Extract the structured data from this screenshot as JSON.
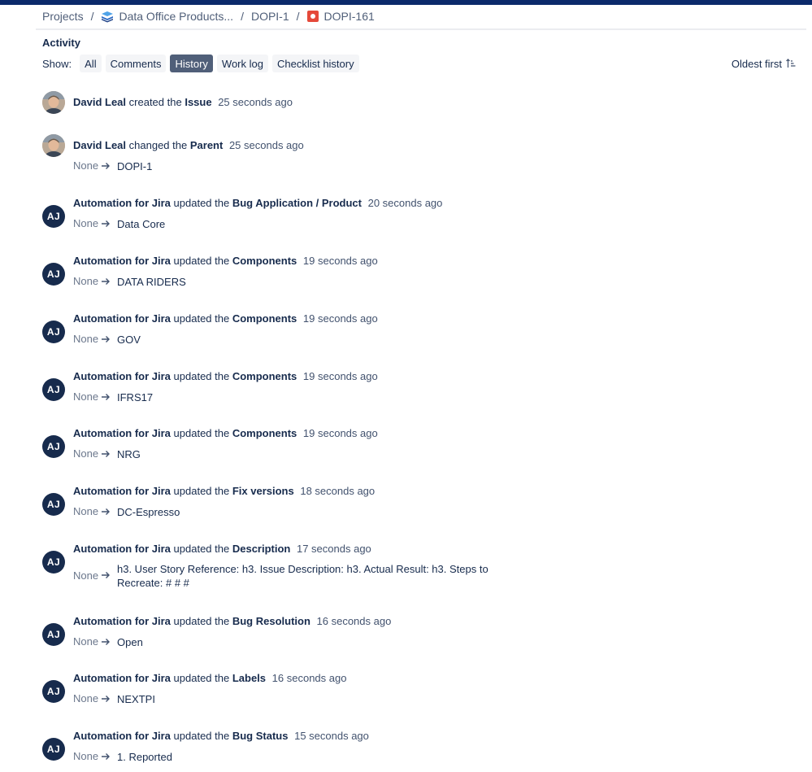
{
  "breadcrumb": {
    "projects": "Projects",
    "project": "Data Office Products...",
    "parent": "DOPI-1",
    "issue": "DOPI-161"
  },
  "activity": {
    "title": "Activity",
    "show_label": "Show:",
    "filters": [
      "All",
      "Comments",
      "History",
      "Work log",
      "Checklist history"
    ],
    "active_filter": "History",
    "sort_label": "Oldest first"
  },
  "colors": {
    "topbar": "#0b2a6b",
    "active_filter": "#505f79",
    "avatar_bot": "#172b4d"
  },
  "entries": [
    {
      "user": "David Leal",
      "avatar": "photo",
      "action": "created the",
      "field": "Issue",
      "time": "25 seconds ago"
    },
    {
      "user": "David Leal",
      "avatar": "photo",
      "action": "changed the",
      "field": "Parent",
      "time": "25 seconds ago",
      "from": "None",
      "to": "DOPI-1"
    },
    {
      "user": "Automation for Jira",
      "avatar": "AJ",
      "action": "updated the",
      "field": "Bug Application / Product",
      "time": "20 seconds ago",
      "from": "None",
      "to": "Data Core"
    },
    {
      "user": "Automation for Jira",
      "avatar": "AJ",
      "action": "updated the",
      "field": "Components",
      "time": "19 seconds ago",
      "from": "None",
      "to": "DATA RIDERS"
    },
    {
      "user": "Automation for Jira",
      "avatar": "AJ",
      "action": "updated the",
      "field": "Components",
      "time": "19 seconds ago",
      "from": "None",
      "to": "GOV"
    },
    {
      "user": "Automation for Jira",
      "avatar": "AJ",
      "action": "updated the",
      "field": "Components",
      "time": "19 seconds ago",
      "from": "None",
      "to": "IFRS17"
    },
    {
      "user": "Automation for Jira",
      "avatar": "AJ",
      "action": "updated the",
      "field": "Components",
      "time": "19 seconds ago",
      "from": "None",
      "to": "NRG"
    },
    {
      "user": "Automation for Jira",
      "avatar": "AJ",
      "action": "updated the",
      "field": "Fix versions",
      "time": "18 seconds ago",
      "from": "None",
      "to": "DC-Espresso"
    },
    {
      "user": "Automation for Jira",
      "avatar": "AJ",
      "action": "updated the",
      "field": "Description",
      "time": "17 seconds ago",
      "from": "None",
      "to": "h3. User Story Reference: h3. Issue Description: h3. Actual Result: h3. Steps to Recreate: # # #"
    },
    {
      "user": "Automation for Jira",
      "avatar": "AJ",
      "action": "updated the",
      "field": "Bug Resolution",
      "time": "16 seconds ago",
      "from": "None",
      "to": "Open"
    },
    {
      "user": "Automation for Jira",
      "avatar": "AJ",
      "action": "updated the",
      "field": "Labels",
      "time": "16 seconds ago",
      "from": "None",
      "to": "NEXTPI"
    },
    {
      "user": "Automation for Jira",
      "avatar": "AJ",
      "action": "updated the",
      "field": "Bug Status",
      "time": "15 seconds ago",
      "from": "None",
      "to": "1. Reported"
    }
  ]
}
